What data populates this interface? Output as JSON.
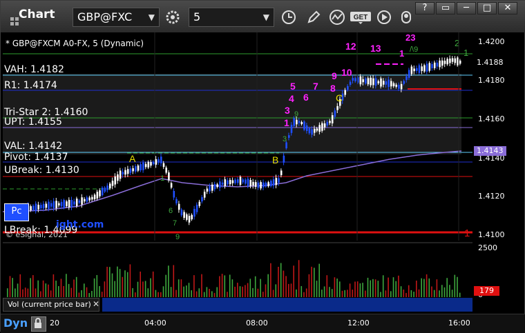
{
  "toolbar": {
    "app_title": "Chart",
    "symbol": "GBP@FXC",
    "interval": "5"
  },
  "chart_header": "* GBP@FXCM A0-FX, 5 (Dynamic)",
  "levels": {
    "vah": "VAH: 1.4182",
    "r1": "R1: 1.4174",
    "tristar": "Tri-Star 2: 1.4160",
    "upt": "UPT: 1.4155",
    "val": "VAL: 1.4142",
    "pivot": "Pivot: 1.4137",
    "ubreak": "UBreak: 1.4130",
    "lbreak": "LBreak: 1.4099"
  },
  "annotations": {
    "a": "A",
    "b": "B",
    "c": "C"
  },
  "count_labels": [
    "12",
    "13",
    "23",
    "2",
    "1",
    "1",
    "9",
    "10",
    "8",
    "7",
    "6",
    "5",
    "4",
    "3",
    "2",
    "1"
  ],
  "watermark": {
    "site": "ight.com",
    "copyright": "© eSignal, 2021"
  },
  "price_axis": {
    "ticks": [
      "1.4200",
      "1.4180",
      "1.4160",
      "1.4140",
      "1.4120",
      "1.4100"
    ],
    "last_price": "1.4188",
    "vwap_price": "1.4143"
  },
  "vol_axis": {
    "max_tick": "2500",
    "zero_tick": "0",
    "current": "179"
  },
  "vol_label": "Vol (current price bar)",
  "time_axis": [
    "20",
    "04:00",
    "08:00",
    "12:00",
    "16:00"
  ],
  "bottom": {
    "dyn": "Dyn"
  },
  "colors": {
    "up_bar": "#ffffff",
    "down_bar": "#1f4fff",
    "vwap": "#8a6dd8",
    "magenta": "#ff22ff",
    "green_count": "#3ea83e",
    "yellow": "#e8e000",
    "red_line": "#e01010",
    "cyan_line": "#5fd0ff",
    "green_line": "#2e9e2e"
  }
}
